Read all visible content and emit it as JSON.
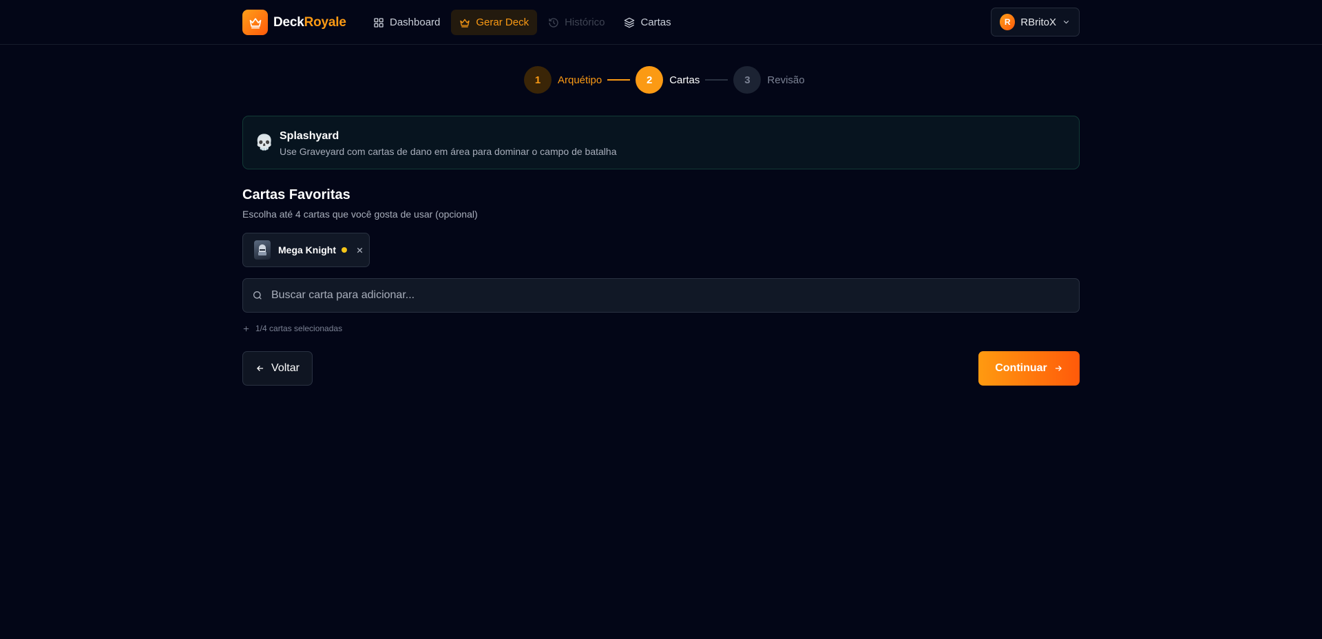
{
  "colors": {
    "accent": "#fb9a14",
    "background": "#030617",
    "teal_border": "#123b36"
  },
  "app": {
    "logo_icon": "crown-icon",
    "name_part1": "Deck",
    "name_part2": "Royale"
  },
  "nav": {
    "items": [
      {
        "label": "Dashboard",
        "icon": "grid-icon",
        "state": "normal"
      },
      {
        "label": "Gerar Deck",
        "icon": "crown-icon",
        "state": "active"
      },
      {
        "label": "Histórico",
        "icon": "history-icon",
        "state": "disabled"
      },
      {
        "label": "Cartas",
        "icon": "layers-icon",
        "state": "normal"
      }
    ]
  },
  "user": {
    "avatar_letter": "R",
    "name": "RBritoX"
  },
  "stepper": {
    "steps": [
      {
        "number": "1",
        "label": "Arquétipo",
        "state": "completed"
      },
      {
        "number": "2",
        "label": "Cartas",
        "state": "current"
      },
      {
        "number": "3",
        "label": "Revisão",
        "state": "upcoming"
      }
    ]
  },
  "archetype": {
    "icon": "skull-icon",
    "title": "Splashyard",
    "description": "Use Graveyard com cartas de dano em área para dominar o campo de batalha"
  },
  "favorites": {
    "title": "Cartas Favoritas",
    "subtitle": "Escolha até 4 cartas que você gosta de usar (opcional)",
    "selected": [
      {
        "name": "Mega Knight",
        "rarity_color": "#f5c518"
      }
    ],
    "search_placeholder": "Buscar carta para adicionar...",
    "count_text": "1/4 cartas selecionadas"
  },
  "actions": {
    "back_label": "Voltar",
    "continue_label": "Continuar"
  }
}
